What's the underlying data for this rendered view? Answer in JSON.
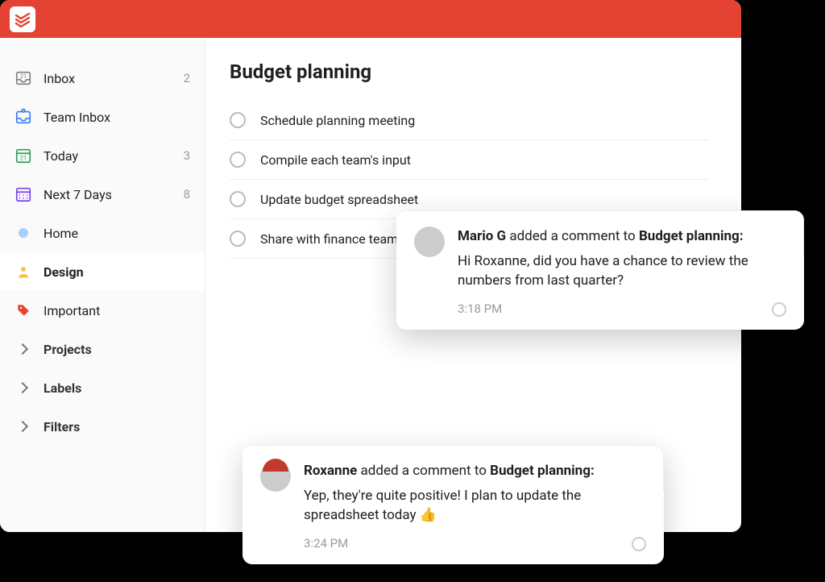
{
  "colors": {
    "brand": "#e44232"
  },
  "sidebar": {
    "items": [
      {
        "id": "inbox",
        "label": "Inbox",
        "count": "2",
        "active": false,
        "icon": "inbox-icon"
      },
      {
        "id": "team-inbox",
        "label": "Team Inbox",
        "count": "",
        "active": false,
        "icon": "team-inbox-icon"
      },
      {
        "id": "today",
        "label": "Today",
        "count": "3",
        "active": false,
        "icon": "today-icon"
      },
      {
        "id": "next7",
        "label": "Next 7 Days",
        "count": "8",
        "active": false,
        "icon": "calendar-icon"
      },
      {
        "id": "home",
        "label": "Home",
        "count": "",
        "active": false,
        "icon": "dot-icon"
      },
      {
        "id": "design",
        "label": "Design",
        "count": "",
        "active": true,
        "icon": "person-icon"
      },
      {
        "id": "important",
        "label": "Important",
        "count": "",
        "active": false,
        "icon": "tag-icon"
      }
    ],
    "sections": [
      {
        "id": "projects",
        "label": "Projects"
      },
      {
        "id": "labels",
        "label": "Labels"
      },
      {
        "id": "filters",
        "label": "Filters"
      }
    ]
  },
  "main": {
    "title": "Budget planning",
    "tasks": [
      {
        "label": "Schedule planning meeting"
      },
      {
        "label": "Compile each team's input"
      },
      {
        "label": "Update budget spreadsheet"
      },
      {
        "label": "Share with finance team"
      }
    ]
  },
  "notifications": [
    {
      "author": "Mario G",
      "middle": " added a comment to ",
      "target": "Budget planning:",
      "body": "Hi Roxanne, did you have a chance to review the numbers from last quarter?",
      "time": "3:18 PM"
    },
    {
      "author": "Roxanne",
      "middle": " added a comment to ",
      "target": "Budget planning:",
      "body": "Yep, they're quite positive! I plan to update the spreadsheet today 👍",
      "time": "3:24 PM"
    }
  ]
}
